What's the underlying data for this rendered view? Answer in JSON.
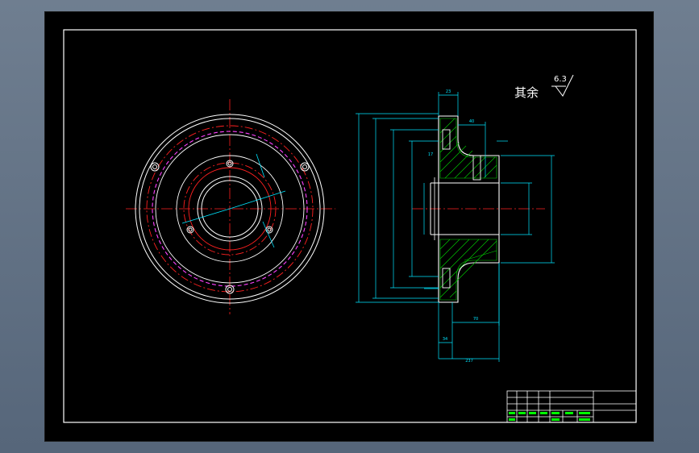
{
  "drawing": {
    "surface_finish_note": "其余",
    "surface_finish_value": "6.3",
    "dimensions": {
      "top_width": "23",
      "hole_offset": "40",
      "bottom_inner": "70",
      "bottom_small": "34",
      "overall_length": "237",
      "left_tag": "17"
    }
  },
  "colors": {
    "background": "#000000",
    "frame": "#ffffff",
    "center_line": "#ff2020",
    "dimension": "#00e5ff",
    "pitch_circle": "#ff40ff",
    "hatch": "#00d000",
    "title_block_text": "#00ff00"
  }
}
